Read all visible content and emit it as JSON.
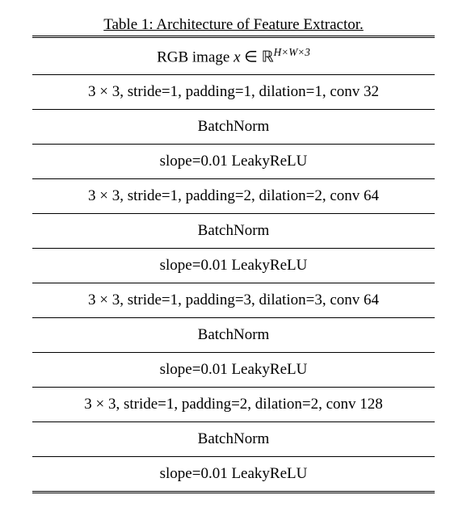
{
  "caption": "Table 1: Architecture of Feature Extractor.",
  "chart_data": {
    "type": "table",
    "title": "Architecture of Feature Extractor",
    "rows": [
      "RGB image x ∈ ℝ^{H×W×3}",
      "3 × 3, stride=1, padding=1, dilation=1, conv 32",
      "BatchNorm",
      "slope=0.01 LeakyReLU",
      "3 × 3, stride=1, padding=2, dilation=2, conv 64",
      "BatchNorm",
      "slope=0.01 LeakyReLU",
      "3 × 3, stride=1, padding=3, dilation=3, conv 64",
      "BatchNorm",
      "slope=0.01 LeakyReLU",
      "3 × 3, stride=1, padding=2, dilation=2, conv 128",
      "BatchNorm",
      "slope=0.01 LeakyReLU"
    ]
  },
  "rows_html": [
    "RGB image <span class=\"math\">x</span> ∈ <span class=\"bb\">ℝ</span><span class=\"sup\">H×W×3</span>",
    "3 × 3, stride=1, padding=1, dilation=1, conv 32",
    "BatchNorm",
    "slope=0.01 LeakyReLU",
    "3 × 3, stride=1, padding=2, dilation=2, conv 64",
    "BatchNorm",
    "slope=0.01 LeakyReLU",
    "3 × 3, stride=1, padding=3, dilation=3, conv 64",
    "BatchNorm",
    "slope=0.01 LeakyReLU",
    "3 × 3, stride=1, padding=2, dilation=2, conv 128",
    "BatchNorm",
    "slope=0.01 LeakyReLU"
  ]
}
